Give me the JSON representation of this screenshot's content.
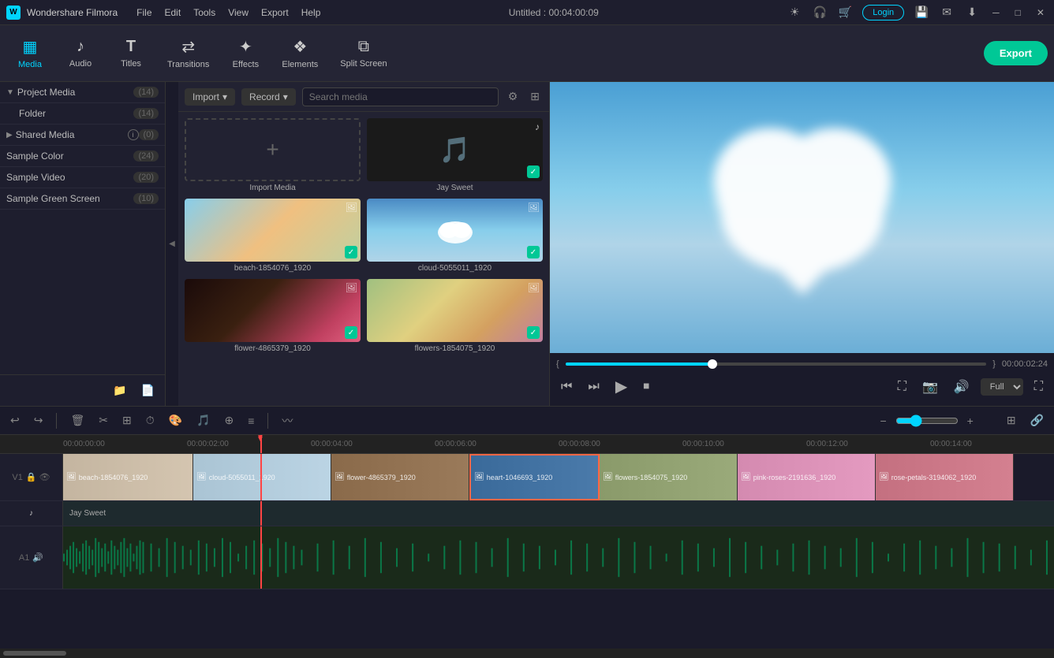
{
  "titlebar": {
    "app_name": "Wondershare Filmora",
    "menu_items": [
      "File",
      "Edit",
      "Tools",
      "View",
      "Export",
      "Help"
    ],
    "project_name": "Untitled",
    "time": "00:04:00:09",
    "login_label": "Login"
  },
  "toolbar": {
    "items": [
      {
        "id": "media",
        "label": "Media",
        "icon": "▦",
        "active": true
      },
      {
        "id": "audio",
        "label": "Audio",
        "icon": "♪"
      },
      {
        "id": "titles",
        "label": "Titles",
        "icon": "T"
      },
      {
        "id": "transitions",
        "label": "Transitions",
        "icon": "⇄"
      },
      {
        "id": "effects",
        "label": "Effects",
        "icon": "✦"
      },
      {
        "id": "elements",
        "label": "Elements",
        "icon": "❖"
      },
      {
        "id": "split_screen",
        "label": "Split Screen",
        "icon": "▦"
      }
    ],
    "export_label": "Export"
  },
  "left_panel": {
    "project_media": {
      "label": "Project Media",
      "count": "(14)"
    },
    "folder": {
      "label": "Folder",
      "count": "(14)"
    },
    "shared_media": {
      "label": "Shared Media",
      "count": "(0)"
    },
    "sample_color": {
      "label": "Sample Color",
      "count": "(24)"
    },
    "sample_video": {
      "label": "Sample Video",
      "count": "(20)"
    },
    "sample_green_screen": {
      "label": "Sample Green Screen",
      "count": "(10)"
    }
  },
  "media_panel": {
    "import_label": "Import",
    "record_label": "Record",
    "search_placeholder": "Search media",
    "import_media_label": "Import Media",
    "media_items": [
      {
        "id": "beach",
        "label": "beach-1854076_1920",
        "type": "video",
        "checked": true,
        "color": "#c4a080"
      },
      {
        "id": "cloud",
        "label": "cloud-5055011_1920",
        "type": "video",
        "checked": true,
        "color": "#aac4d4"
      },
      {
        "id": "flower",
        "label": "flower-4865379_1920",
        "type": "video",
        "checked": true,
        "color": "#4a3020"
      },
      {
        "id": "flowers",
        "label": "flowers-1854075_1920",
        "type": "video",
        "checked": true,
        "color": "#8a9070"
      }
    ],
    "jay_sweet_label": "Jay Sweet"
  },
  "preview": {
    "current_time": "00:00:02:24",
    "quality": "Full",
    "seekbar_percent": 35
  },
  "timeline": {
    "toolbar_buttons": [
      "undo",
      "redo",
      "delete",
      "cut",
      "crop",
      "speed",
      "color",
      "audio",
      "stabilize",
      "mix"
    ],
    "ruler_marks": [
      "00:00:00:00",
      "00:00:02:00",
      "00:00:04:00",
      "00:00:06:00",
      "00:00:08:00",
      "00:00:10:00",
      "00:00:12:00",
      "00:00:14:00"
    ],
    "tracks": [
      {
        "number": "1",
        "type": "video",
        "clips": [
          {
            "label": "beach-1854076_1920",
            "class": "clip-beach"
          },
          {
            "label": "cloud-5055011_1920",
            "class": "clip-cloud"
          },
          {
            "label": "flower-4865379_1920",
            "class": "clip-flower"
          },
          {
            "label": "heart-1046693_1920",
            "class": "clip-heart"
          },
          {
            "label": "flowers-1854075_1920",
            "class": "clip-flowers2"
          },
          {
            "label": "pink-roses-2191636_1920",
            "class": "clip-pink"
          },
          {
            "label": "rose-petals-3194062_1920",
            "class": "clip-rose"
          }
        ]
      }
    ],
    "jay_sweet_label": "Jay Sweet",
    "audio_track_number": "1"
  }
}
